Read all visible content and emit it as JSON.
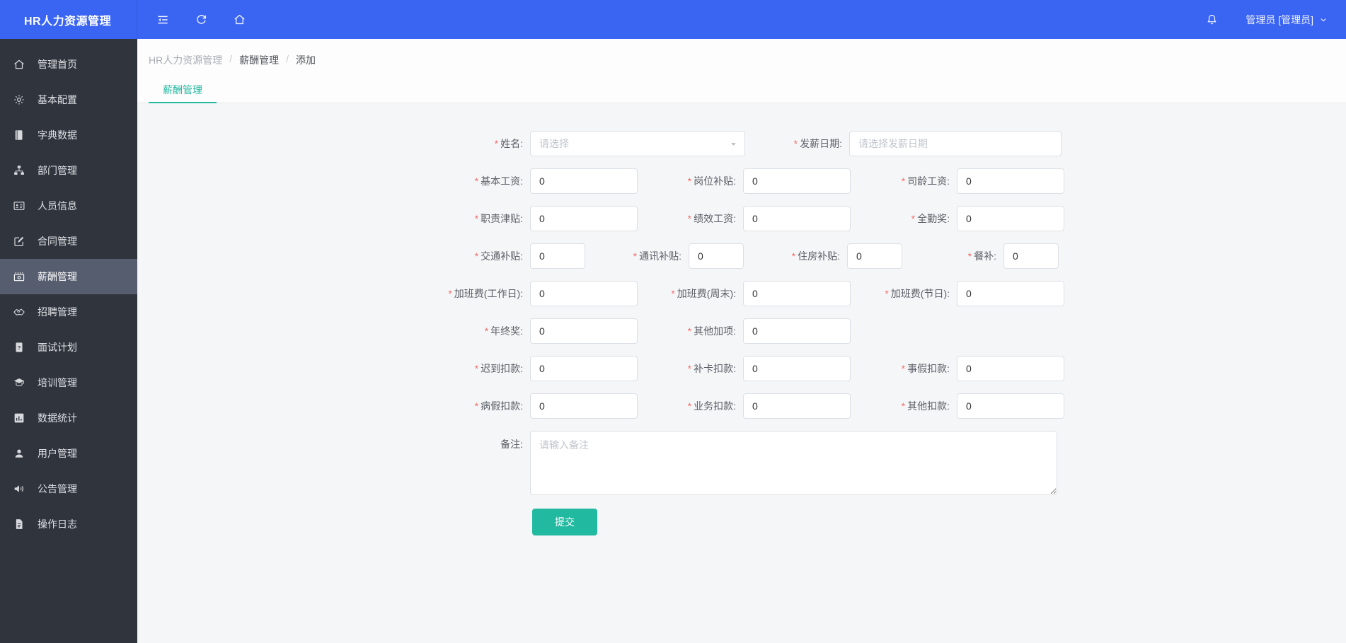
{
  "header": {
    "app_title": "HR人力资源管理",
    "user_label": "管理员 [管理员]",
    "icons": [
      "collapse-icon",
      "refresh-icon",
      "home-icon",
      "bell-icon",
      "chevron-down-icon"
    ]
  },
  "sidebar": {
    "items": [
      {
        "label": "管理首页",
        "icon": "home-icon",
        "active": false
      },
      {
        "label": "基本配置",
        "icon": "gear-icon",
        "active": false
      },
      {
        "label": "字典数据",
        "icon": "book-icon",
        "active": false
      },
      {
        "label": "部门管理",
        "icon": "sitemap-icon",
        "active": false
      },
      {
        "label": "人员信息",
        "icon": "id-card-icon",
        "active": false
      },
      {
        "label": "合同管理",
        "icon": "contract-icon",
        "active": false
      },
      {
        "label": "薪酬管理",
        "icon": "money-icon",
        "active": true
      },
      {
        "label": "招聘管理",
        "icon": "handshake-icon",
        "active": false
      },
      {
        "label": "面试计划",
        "icon": "interview-icon",
        "active": false
      },
      {
        "label": "培训管理",
        "icon": "graduation-icon",
        "active": false
      },
      {
        "label": "数据统计",
        "icon": "chart-icon",
        "active": false
      },
      {
        "label": "用户管理",
        "icon": "user-icon",
        "active": false
      },
      {
        "label": "公告管理",
        "icon": "megaphone-icon",
        "active": false
      },
      {
        "label": "操作日志",
        "icon": "log-icon",
        "active": false
      }
    ]
  },
  "breadcrumb": {
    "items": [
      "HR人力资源管理",
      "薪酬管理",
      "添加"
    ],
    "separator": "/"
  },
  "tabs": {
    "active_label": "薪酬管理"
  },
  "form": {
    "required_marker": "*",
    "name": {
      "label": "姓名:",
      "placeholder": "请选择"
    },
    "pay_date": {
      "label": "发薪日期:",
      "placeholder": "请选择发薪日期"
    },
    "money_fields": [
      {
        "label": "基本工资:",
        "value": "0"
      },
      {
        "label": "岗位补贴:",
        "value": "0"
      },
      {
        "label": "司龄工资:",
        "value": "0"
      },
      {
        "label": "职责津贴:",
        "value": "0"
      },
      {
        "label": "绩效工资:",
        "value": "0"
      },
      {
        "label": "全勤奖:",
        "value": "0"
      },
      {
        "label": "交通补贴:",
        "value": "0"
      },
      {
        "label": "通讯补贴:",
        "value": "0"
      },
      {
        "label": "住房补贴:",
        "value": "0"
      },
      {
        "label": "餐补:",
        "value": "0"
      },
      {
        "label": "加班费(工作日):",
        "value": "0"
      },
      {
        "label": "加班费(周末):",
        "value": "0"
      },
      {
        "label": "加班费(节日):",
        "value": "0"
      },
      {
        "label": "年终奖:",
        "value": "0"
      },
      {
        "label": "其他加项:",
        "value": "0"
      },
      {
        "label": "迟到扣款:",
        "value": "0"
      },
      {
        "label": "补卡扣款:",
        "value": "0"
      },
      {
        "label": "事假扣款:",
        "value": "0"
      },
      {
        "label": "病假扣款:",
        "value": "0"
      },
      {
        "label": "业务扣款:",
        "value": "0"
      },
      {
        "label": "其他扣款:",
        "value": "0"
      }
    ],
    "remark": {
      "label": "备注:",
      "placeholder": "请输入备注"
    },
    "submit_label": "提交"
  },
  "colors": {
    "header_bg": "#3a64f2",
    "sidebar_bg": "#2f343d",
    "sidebar_active_bg": "#565d6e",
    "accent_teal": "#21b9a0",
    "required_red": "#f56c6c",
    "input_border": "#dcdfe6"
  }
}
